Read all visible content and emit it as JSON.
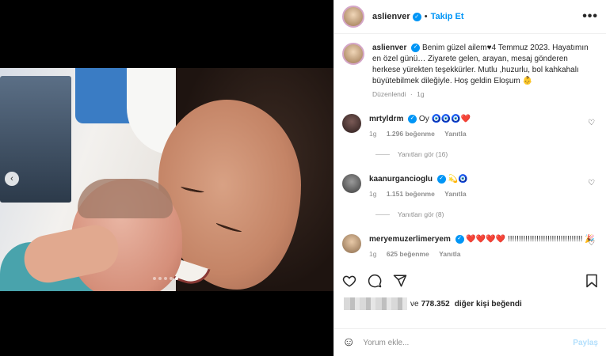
{
  "post": {
    "username": "aslienver",
    "follow_label": "Takip Et",
    "separator": "•",
    "more_label": "•••",
    "caption": "Benim güzel ailem♥4 Temmuz 2023. Hayatımın en özel günü… Ziyarete gelen, arayan, mesaj gönderen herkese yürekten teşekkürler. Mutlu ,huzurlu, bol kahkahalı büyütebilmek dileğiyle. Hoş geldin Eloşum 👶",
    "edited_label": "Düzenlendi",
    "edited_time": "1g"
  },
  "comments": [
    {
      "username": "mrtyldrm",
      "text": "Oy 🧿🧿🧿❤️",
      "time": "1g",
      "likes": "1.296 beğenme",
      "reply": "Yanıtla",
      "view_replies": "Yanıtları gör (16)"
    },
    {
      "username": "kaanurgancioglu",
      "text": "💫🧿",
      "time": "1g",
      "likes": "1.151 beğenme",
      "reply": "Yanıtla",
      "view_replies": "Yanıtları gör (8)"
    },
    {
      "username": "meryemuzerlimeryem",
      "text": "❤️❤️❤️❤️ !!!!!!!!!!!!!!!!!!!!!!!!!!!!!!!!!! 🎉",
      "time": "1g",
      "likes": "625 beğenme",
      "reply": "Yanıtla",
      "view_replies": ""
    }
  ],
  "likes_summary": {
    "prefix": "ve",
    "count": "778.352",
    "suffix": "diğer kişi beğendi"
  },
  "comment_input": {
    "placeholder": "Yorum ekle...",
    "post_label": "Paylaş"
  },
  "carousel": {
    "total": 5,
    "active_index": 4
  },
  "icons": {
    "like": "heart-icon",
    "comment": "comment-icon",
    "share": "paper-plane-icon",
    "save": "bookmark-icon",
    "emoji": "smiley-icon"
  },
  "colors": {
    "accent": "#0095f6",
    "like_red": "#ed4956",
    "muted": "#8e8e8e"
  }
}
